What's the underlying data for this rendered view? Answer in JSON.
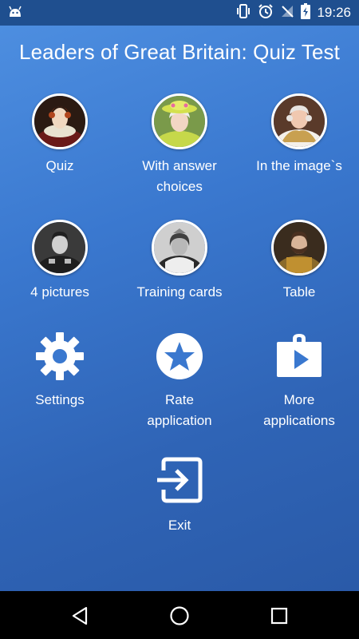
{
  "status_bar": {
    "time": "19:26",
    "icons": [
      "android-icon",
      "vibrate-icon",
      "alarm-icon",
      "no-signal-icon",
      "battery-charging-icon"
    ]
  },
  "app": {
    "title": "Leaders of Great Britain: Quiz Test"
  },
  "menu": {
    "quiz": "Quiz",
    "answer_choices_line1": "With answer",
    "answer_choices_line2": "choices",
    "in_image": "In the image`s",
    "four_pictures": "4 pictures",
    "training_cards": "Training cards",
    "table": "Table",
    "settings": "Settings",
    "rate_line1": "Rate",
    "rate_line2": "application",
    "more_line1": "More",
    "more_line2": "applications",
    "exit": "Exit"
  },
  "nav_bar": {
    "buttons": [
      "back-icon",
      "home-icon",
      "recents-icon"
    ]
  },
  "colors": {
    "background_top": "#4d8ee0",
    "background_bottom": "#2a5aa8",
    "status_bar": "#1f4f8f",
    "text": "#ffffff"
  }
}
